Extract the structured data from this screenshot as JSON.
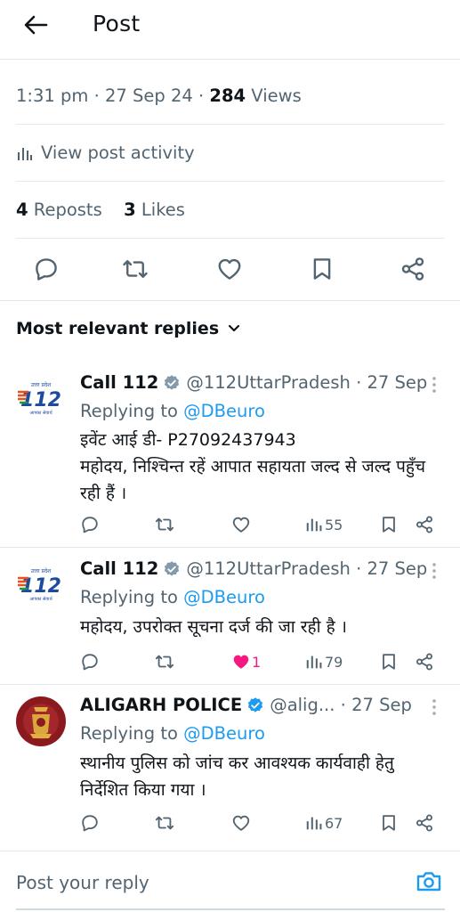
{
  "header": {
    "title": "Post"
  },
  "stats": {
    "time": "1:31 pm",
    "date": "27 Sep 24",
    "views_count": "284",
    "views_label": "Views",
    "activity_label": "View post activity",
    "reposts_count": "4",
    "reposts_label": "Reposts",
    "likes_count": "3",
    "likes_label": "Likes"
  },
  "actions": [
    "reply-icon",
    "repost-icon",
    "like-icon",
    "bookmark-icon",
    "share-icon"
  ],
  "sort": {
    "label": "Most relevant replies"
  },
  "replies": [
    {
      "name": "Call 112",
      "handle": "@112UttarPradesh",
      "date": "27 Sep",
      "replying_prefix": "Replying to",
      "replying_to": "@DBeuro",
      "lines": [
        "इवेंट आई डी- P27092437943",
        "महोदय, निश्चिन्त रहें आपात सहायता जल्द से जल्द पहुँच रही हैं ।"
      ],
      "likes": "",
      "views": "55",
      "liked": false
    },
    {
      "name": "Call 112",
      "handle": "@112UttarPradesh",
      "date": "27 Sep",
      "replying_prefix": "Replying to",
      "replying_to": "@DBeuro",
      "lines": [
        "महोदय, उपरोक्त सूचना दर्ज की जा रही है ।"
      ],
      "likes": "1",
      "views": "79",
      "liked": true
    },
    {
      "name": "ALIGARH POLICE",
      "handle": "@alig...",
      "date": "27 Sep",
      "replying_prefix": "Replying to",
      "replying_to": "@DBeuro",
      "lines": [
        "स्थानीय पुलिस को जांच कर आवश्यक कार्यवाही हेतु निर्देशित किया गया ।"
      ],
      "likes": "",
      "views": "67",
      "liked": false
    }
  ],
  "reply_bar": {
    "placeholder": "Post your reply"
  },
  "logo_text": {
    "call112_top": "उत्तर प्रदेश",
    "call112_number": "112",
    "call112_bottom": "आपका सेवार्थ"
  },
  "colors": {
    "accent": "#1d9bf0",
    "liked": "#f91880",
    "gray": "#536471",
    "verified": "#829aab"
  }
}
